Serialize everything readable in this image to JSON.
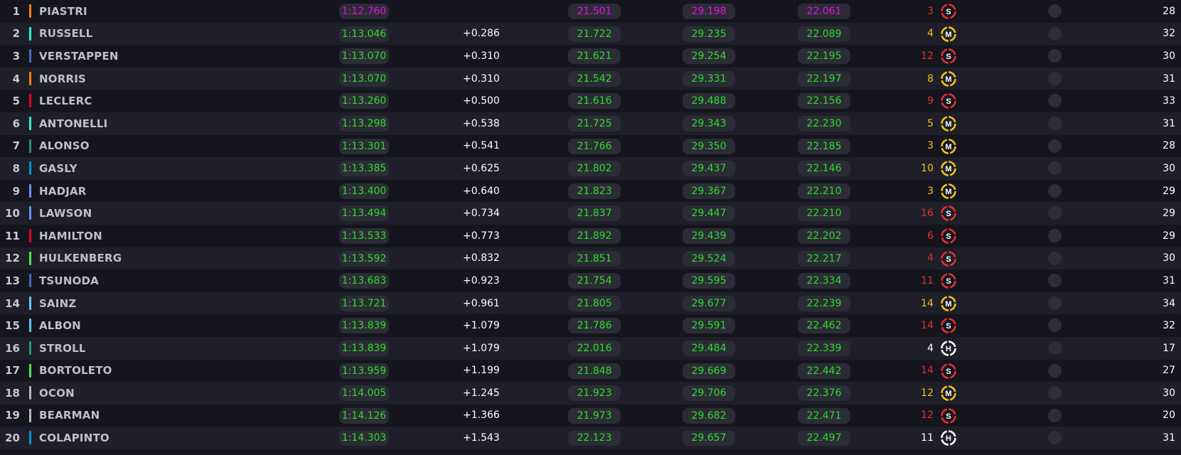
{
  "colors": {
    "fastest": "#e40fe4",
    "personal_best": "#2bdc2b",
    "soft": "#e03030",
    "medium": "#f2c318",
    "hard": "#ffffff"
  },
  "rows": [
    {
      "pos": "1",
      "driver": "PIASTRI",
      "team_color": "#ff8000",
      "lap": "1:12.760",
      "lap_purple": true,
      "gap": "",
      "s1": "21.501",
      "s1_purple": true,
      "s2": "29.198",
      "s2_purple": true,
      "s3": "22.061",
      "s3_purple": true,
      "tyre_laps": "3",
      "tyre": "S",
      "laps": "28"
    },
    {
      "pos": "2",
      "driver": "RUSSELL",
      "team_color": "#27f4d2",
      "lap": "1:13.046",
      "lap_purple": false,
      "gap": "+0.286",
      "s1": "21.722",
      "s1_purple": false,
      "s2": "29.235",
      "s2_purple": false,
      "s3": "22.089",
      "s3_purple": false,
      "tyre_laps": "4",
      "tyre": "M",
      "laps": "32"
    },
    {
      "pos": "3",
      "driver": "VERSTAPPEN",
      "team_color": "#3671c6",
      "lap": "1:13.070",
      "lap_purple": false,
      "gap": "+0.310",
      "s1": "21.621",
      "s1_purple": false,
      "s2": "29.254",
      "s2_purple": false,
      "s3": "22.195",
      "s3_purple": false,
      "tyre_laps": "12",
      "tyre": "S",
      "laps": "30"
    },
    {
      "pos": "4",
      "driver": "NORRIS",
      "team_color": "#ff8000",
      "lap": "1:13.070",
      "lap_purple": false,
      "gap": "+0.310",
      "s1": "21.542",
      "s1_purple": false,
      "s2": "29.331",
      "s2_purple": false,
      "s3": "22.197",
      "s3_purple": false,
      "tyre_laps": "8",
      "tyre": "M",
      "laps": "31"
    },
    {
      "pos": "5",
      "driver": "LECLERC",
      "team_color": "#e8002d",
      "lap": "1:13.260",
      "lap_purple": false,
      "gap": "+0.500",
      "s1": "21.616",
      "s1_purple": false,
      "s2": "29.488",
      "s2_purple": false,
      "s3": "22.156",
      "s3_purple": false,
      "tyre_laps": "9",
      "tyre": "S",
      "laps": "33"
    },
    {
      "pos": "6",
      "driver": "ANTONELLI",
      "team_color": "#27f4d2",
      "lap": "1:13.298",
      "lap_purple": false,
      "gap": "+0.538",
      "s1": "21.725",
      "s1_purple": false,
      "s2": "29.343",
      "s2_purple": false,
      "s3": "22.230",
      "s3_purple": false,
      "tyre_laps": "5",
      "tyre": "M",
      "laps": "31"
    },
    {
      "pos": "7",
      "driver": "ALONSO",
      "team_color": "#229971",
      "lap": "1:13.301",
      "lap_purple": false,
      "gap": "+0.541",
      "s1": "21.766",
      "s1_purple": false,
      "s2": "29.350",
      "s2_purple": false,
      "s3": "22.185",
      "s3_purple": false,
      "tyre_laps": "3",
      "tyre": "M",
      "laps": "28"
    },
    {
      "pos": "8",
      "driver": "GASLY",
      "team_color": "#0093cc",
      "lap": "1:13.385",
      "lap_purple": false,
      "gap": "+0.625",
      "s1": "21.802",
      "s1_purple": false,
      "s2": "29.437",
      "s2_purple": false,
      "s3": "22.146",
      "s3_purple": false,
      "tyre_laps": "10",
      "tyre": "M",
      "laps": "30"
    },
    {
      "pos": "9",
      "driver": "HADJAR",
      "team_color": "#6692ff",
      "lap": "1:13.400",
      "lap_purple": false,
      "gap": "+0.640",
      "s1": "21.823",
      "s1_purple": false,
      "s2": "29.367",
      "s2_purple": false,
      "s3": "22.210",
      "s3_purple": false,
      "tyre_laps": "3",
      "tyre": "M",
      "laps": "29"
    },
    {
      "pos": "10",
      "driver": "LAWSON",
      "team_color": "#6692ff",
      "lap": "1:13.494",
      "lap_purple": false,
      "gap": "+0.734",
      "s1": "21.837",
      "s1_purple": false,
      "s2": "29.447",
      "s2_purple": false,
      "s3": "22.210",
      "s3_purple": false,
      "tyre_laps": "16",
      "tyre": "S",
      "laps": "29"
    },
    {
      "pos": "11",
      "driver": "HAMILTON",
      "team_color": "#e8002d",
      "lap": "1:13.533",
      "lap_purple": false,
      "gap": "+0.773",
      "s1": "21.892",
      "s1_purple": false,
      "s2": "29.439",
      "s2_purple": false,
      "s3": "22.202",
      "s3_purple": false,
      "tyre_laps": "6",
      "tyre": "S",
      "laps": "29"
    },
    {
      "pos": "12",
      "driver": "HULKENBERG",
      "team_color": "#52e252",
      "lap": "1:13.592",
      "lap_purple": false,
      "gap": "+0.832",
      "s1": "21.851",
      "s1_purple": false,
      "s2": "29.524",
      "s2_purple": false,
      "s3": "22.217",
      "s3_purple": false,
      "tyre_laps": "4",
      "tyre": "S",
      "laps": "30"
    },
    {
      "pos": "13",
      "driver": "TSUNODA",
      "team_color": "#3671c6",
      "lap": "1:13.683",
      "lap_purple": false,
      "gap": "+0.923",
      "s1": "21.754",
      "s1_purple": false,
      "s2": "29.595",
      "s2_purple": false,
      "s3": "22.334",
      "s3_purple": false,
      "tyre_laps": "11",
      "tyre": "S",
      "laps": "31"
    },
    {
      "pos": "14",
      "driver": "SAINZ",
      "team_color": "#64c4ff",
      "lap": "1:13.721",
      "lap_purple": false,
      "gap": "+0.961",
      "s1": "21.805",
      "s1_purple": false,
      "s2": "29.677",
      "s2_purple": false,
      "s3": "22.239",
      "s3_purple": false,
      "tyre_laps": "14",
      "tyre": "M",
      "laps": "34"
    },
    {
      "pos": "15",
      "driver": "ALBON",
      "team_color": "#64c4ff",
      "lap": "1:13.839",
      "lap_purple": false,
      "gap": "+1.079",
      "s1": "21.786",
      "s1_purple": false,
      "s2": "29.591",
      "s2_purple": false,
      "s3": "22.462",
      "s3_purple": false,
      "tyre_laps": "14",
      "tyre": "S",
      "laps": "32"
    },
    {
      "pos": "16",
      "driver": "STROLL",
      "team_color": "#229971",
      "lap": "1:13.839",
      "lap_purple": false,
      "gap": "+1.079",
      "s1": "22.016",
      "s1_purple": false,
      "s2": "29.484",
      "s2_purple": false,
      "s3": "22.339",
      "s3_purple": false,
      "tyre_laps": "4",
      "tyre": "H",
      "laps": "17"
    },
    {
      "pos": "17",
      "driver": "BORTOLETO",
      "team_color": "#52e252",
      "lap": "1:13.959",
      "lap_purple": false,
      "gap": "+1.199",
      "s1": "21.848",
      "s1_purple": false,
      "s2": "29.669",
      "s2_purple": false,
      "s3": "22.442",
      "s3_purple": false,
      "tyre_laps": "14",
      "tyre": "S",
      "laps": "27"
    },
    {
      "pos": "18",
      "driver": "OCON",
      "team_color": "#b6babd",
      "lap": "1:14.005",
      "lap_purple": false,
      "gap": "+1.245",
      "s1": "21.923",
      "s1_purple": false,
      "s2": "29.706",
      "s2_purple": false,
      "s3": "22.376",
      "s3_purple": false,
      "tyre_laps": "12",
      "tyre": "M",
      "laps": "30"
    },
    {
      "pos": "19",
      "driver": "BEARMAN",
      "team_color": "#b6babd",
      "lap": "1:14.126",
      "lap_purple": false,
      "gap": "+1.366",
      "s1": "21.973",
      "s1_purple": false,
      "s2": "29.682",
      "s2_purple": false,
      "s3": "22.471",
      "s3_purple": false,
      "tyre_laps": "12",
      "tyre": "S",
      "laps": "20"
    },
    {
      "pos": "20",
      "driver": "COLAPINTO",
      "team_color": "#0093cc",
      "lap": "1:14.303",
      "lap_purple": false,
      "gap": "+1.543",
      "s1": "22.123",
      "s1_purple": false,
      "s2": "29.657",
      "s2_purple": false,
      "s3": "22.497",
      "s3_purple": false,
      "tyre_laps": "11",
      "tyre": "H",
      "laps": "31"
    }
  ]
}
